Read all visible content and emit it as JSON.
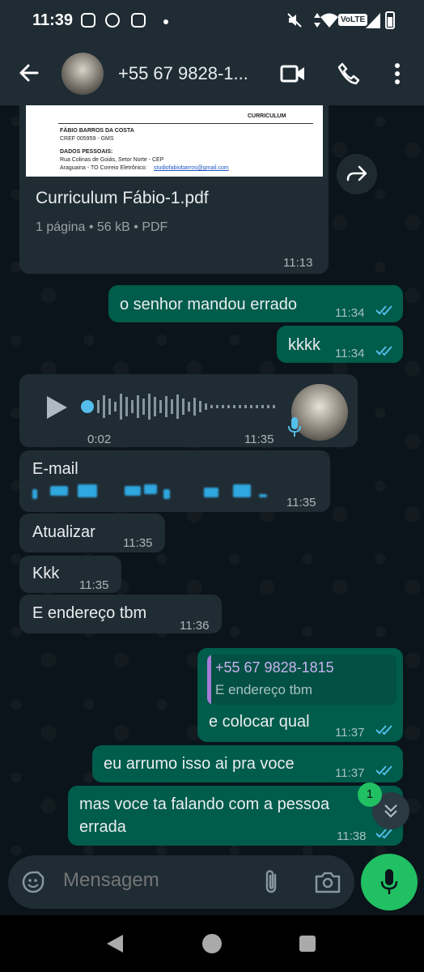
{
  "status_bar": {
    "time": "11:39",
    "network_badge": "VoLTE"
  },
  "header": {
    "contact": "+55 67 9828-1..."
  },
  "document": {
    "preview_title": "CURRICULUM",
    "preview_name": "FÁBIO BARROS DA COSTA",
    "preview_cref": "CREF 005959 - GMS",
    "preview_section": "DADOS PESSOAIS:",
    "preview_address": "Rua Colinas de Goiás, Setor Norte - CEP",
    "preview_city": "Araguaina - TO Correio Eletrônico:",
    "preview_email": "studiofabiobarros@gmail.com",
    "file_name": "Curriculum Fábio-1.pdf",
    "pages": "1 página",
    "size": "56 kB",
    "type": "PDF",
    "time": "11:13"
  },
  "messages": [
    {
      "text": "o senhor mandou errado",
      "time": "11:34"
    },
    {
      "text": "kkkk",
      "time": "11:34"
    },
    {
      "text": "E-mail",
      "time": "11:35"
    },
    {
      "text": "Atualizar",
      "time": "11:35"
    },
    {
      "text": "Kkk",
      "time": "11:35"
    },
    {
      "text": "E endereço tbm",
      "time": "11:36"
    },
    {
      "text": "e colocar qual",
      "time": "11:37"
    },
    {
      "text": "eu arrumo isso ai pra voce",
      "time": "11:37"
    },
    {
      "text": "mas voce ta falando com a pessoa",
      "text2": "errada",
      "time": "11:38"
    }
  ],
  "voice": {
    "duration": "0:02",
    "time": "11:35"
  },
  "reply_quote": {
    "name": "+55 67 9828-1815",
    "text": "E endereço tbm"
  },
  "unread_count": "1",
  "input": {
    "placeholder": "Mensagem"
  },
  "colors": {
    "incoming": "#202c33",
    "outgoing": "#005c4b",
    "accent": "#21c063",
    "read_ticks": "#53bdeb"
  }
}
